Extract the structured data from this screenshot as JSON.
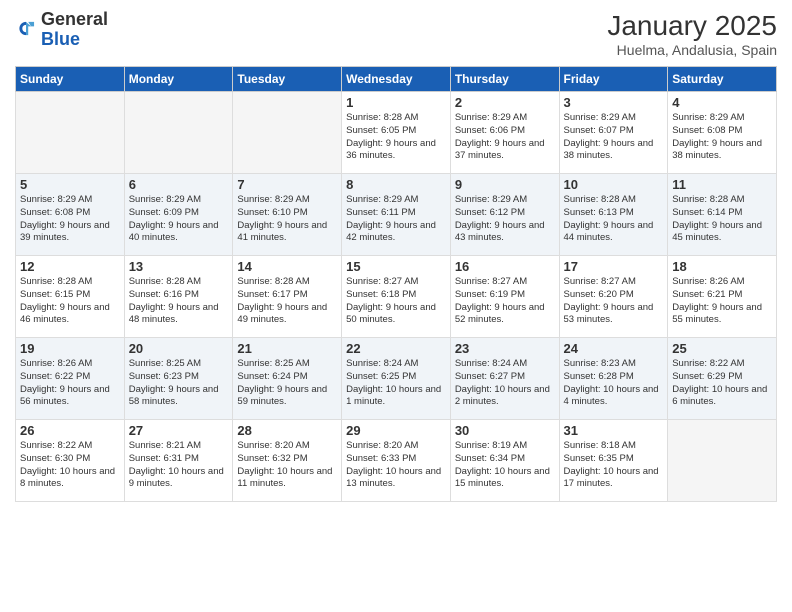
{
  "header": {
    "logo_line1": "General",
    "logo_line2": "Blue",
    "month": "January 2025",
    "location": "Huelma, Andalusia, Spain"
  },
  "days_of_week": [
    "Sunday",
    "Monday",
    "Tuesday",
    "Wednesday",
    "Thursday",
    "Friday",
    "Saturday"
  ],
  "weeks": [
    {
      "shaded": false,
      "days": [
        {
          "num": "",
          "info": ""
        },
        {
          "num": "",
          "info": ""
        },
        {
          "num": "",
          "info": ""
        },
        {
          "num": "1",
          "info": "Sunrise: 8:28 AM\nSunset: 6:05 PM\nDaylight: 9 hours and 36 minutes."
        },
        {
          "num": "2",
          "info": "Sunrise: 8:29 AM\nSunset: 6:06 PM\nDaylight: 9 hours and 37 minutes."
        },
        {
          "num": "3",
          "info": "Sunrise: 8:29 AM\nSunset: 6:07 PM\nDaylight: 9 hours and 38 minutes."
        },
        {
          "num": "4",
          "info": "Sunrise: 8:29 AM\nSunset: 6:08 PM\nDaylight: 9 hours and 38 minutes."
        }
      ]
    },
    {
      "shaded": true,
      "days": [
        {
          "num": "5",
          "info": "Sunrise: 8:29 AM\nSunset: 6:08 PM\nDaylight: 9 hours and 39 minutes."
        },
        {
          "num": "6",
          "info": "Sunrise: 8:29 AM\nSunset: 6:09 PM\nDaylight: 9 hours and 40 minutes."
        },
        {
          "num": "7",
          "info": "Sunrise: 8:29 AM\nSunset: 6:10 PM\nDaylight: 9 hours and 41 minutes."
        },
        {
          "num": "8",
          "info": "Sunrise: 8:29 AM\nSunset: 6:11 PM\nDaylight: 9 hours and 42 minutes."
        },
        {
          "num": "9",
          "info": "Sunrise: 8:29 AM\nSunset: 6:12 PM\nDaylight: 9 hours and 43 minutes."
        },
        {
          "num": "10",
          "info": "Sunrise: 8:28 AM\nSunset: 6:13 PM\nDaylight: 9 hours and 44 minutes."
        },
        {
          "num": "11",
          "info": "Sunrise: 8:28 AM\nSunset: 6:14 PM\nDaylight: 9 hours and 45 minutes."
        }
      ]
    },
    {
      "shaded": false,
      "days": [
        {
          "num": "12",
          "info": "Sunrise: 8:28 AM\nSunset: 6:15 PM\nDaylight: 9 hours and 46 minutes."
        },
        {
          "num": "13",
          "info": "Sunrise: 8:28 AM\nSunset: 6:16 PM\nDaylight: 9 hours and 48 minutes."
        },
        {
          "num": "14",
          "info": "Sunrise: 8:28 AM\nSunset: 6:17 PM\nDaylight: 9 hours and 49 minutes."
        },
        {
          "num": "15",
          "info": "Sunrise: 8:27 AM\nSunset: 6:18 PM\nDaylight: 9 hours and 50 minutes."
        },
        {
          "num": "16",
          "info": "Sunrise: 8:27 AM\nSunset: 6:19 PM\nDaylight: 9 hours and 52 minutes."
        },
        {
          "num": "17",
          "info": "Sunrise: 8:27 AM\nSunset: 6:20 PM\nDaylight: 9 hours and 53 minutes."
        },
        {
          "num": "18",
          "info": "Sunrise: 8:26 AM\nSunset: 6:21 PM\nDaylight: 9 hours and 55 minutes."
        }
      ]
    },
    {
      "shaded": true,
      "days": [
        {
          "num": "19",
          "info": "Sunrise: 8:26 AM\nSunset: 6:22 PM\nDaylight: 9 hours and 56 minutes."
        },
        {
          "num": "20",
          "info": "Sunrise: 8:25 AM\nSunset: 6:23 PM\nDaylight: 9 hours and 58 minutes."
        },
        {
          "num": "21",
          "info": "Sunrise: 8:25 AM\nSunset: 6:24 PM\nDaylight: 9 hours and 59 minutes."
        },
        {
          "num": "22",
          "info": "Sunrise: 8:24 AM\nSunset: 6:25 PM\nDaylight: 10 hours and 1 minute."
        },
        {
          "num": "23",
          "info": "Sunrise: 8:24 AM\nSunset: 6:27 PM\nDaylight: 10 hours and 2 minutes."
        },
        {
          "num": "24",
          "info": "Sunrise: 8:23 AM\nSunset: 6:28 PM\nDaylight: 10 hours and 4 minutes."
        },
        {
          "num": "25",
          "info": "Sunrise: 8:22 AM\nSunset: 6:29 PM\nDaylight: 10 hours and 6 minutes."
        }
      ]
    },
    {
      "shaded": false,
      "days": [
        {
          "num": "26",
          "info": "Sunrise: 8:22 AM\nSunset: 6:30 PM\nDaylight: 10 hours and 8 minutes."
        },
        {
          "num": "27",
          "info": "Sunrise: 8:21 AM\nSunset: 6:31 PM\nDaylight: 10 hours and 9 minutes."
        },
        {
          "num": "28",
          "info": "Sunrise: 8:20 AM\nSunset: 6:32 PM\nDaylight: 10 hours and 11 minutes."
        },
        {
          "num": "29",
          "info": "Sunrise: 8:20 AM\nSunset: 6:33 PM\nDaylight: 10 hours and 13 minutes."
        },
        {
          "num": "30",
          "info": "Sunrise: 8:19 AM\nSunset: 6:34 PM\nDaylight: 10 hours and 15 minutes."
        },
        {
          "num": "31",
          "info": "Sunrise: 8:18 AM\nSunset: 6:35 PM\nDaylight: 10 hours and 17 minutes."
        },
        {
          "num": "",
          "info": ""
        }
      ]
    }
  ]
}
